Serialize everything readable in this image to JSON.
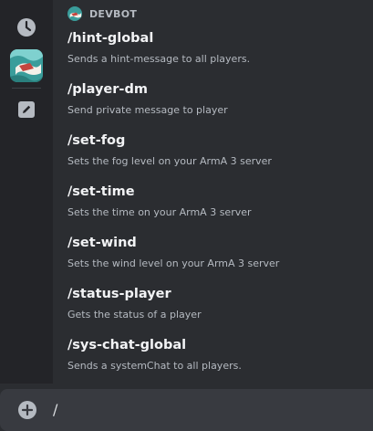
{
  "autocomplete": {
    "section_title": "DEVBOT",
    "rail": {
      "recent_icon": "clock-icon",
      "bot_icon": "bot-avatar-icon",
      "app_icon": "pencil-icon"
    },
    "commands": [
      {
        "name": "/hint-global",
        "description": "Sends a hint-message to all players."
      },
      {
        "name": "/player-dm",
        "description": "Send private message to player"
      },
      {
        "name": "/set-fog",
        "description": "Sets the fog level on your ArmA 3 server"
      },
      {
        "name": "/set-time",
        "description": "Sets the time on your ArmA 3 server"
      },
      {
        "name": "/set-wind",
        "description": "Sets the wind level on your ArmA 3 server"
      },
      {
        "name": "/status-player",
        "description": "Gets the status of a player"
      },
      {
        "name": "/sys-chat-global",
        "description": "Sends a systemChat to all players."
      }
    ]
  },
  "composer": {
    "plus_icon": "plus-circle-icon",
    "value": "/"
  },
  "colors": {
    "background": "#2b2d31",
    "rail": "#232428",
    "composer": "#383a40",
    "text_primary": "#f2f3f5",
    "text_muted": "#b5bac1"
  }
}
